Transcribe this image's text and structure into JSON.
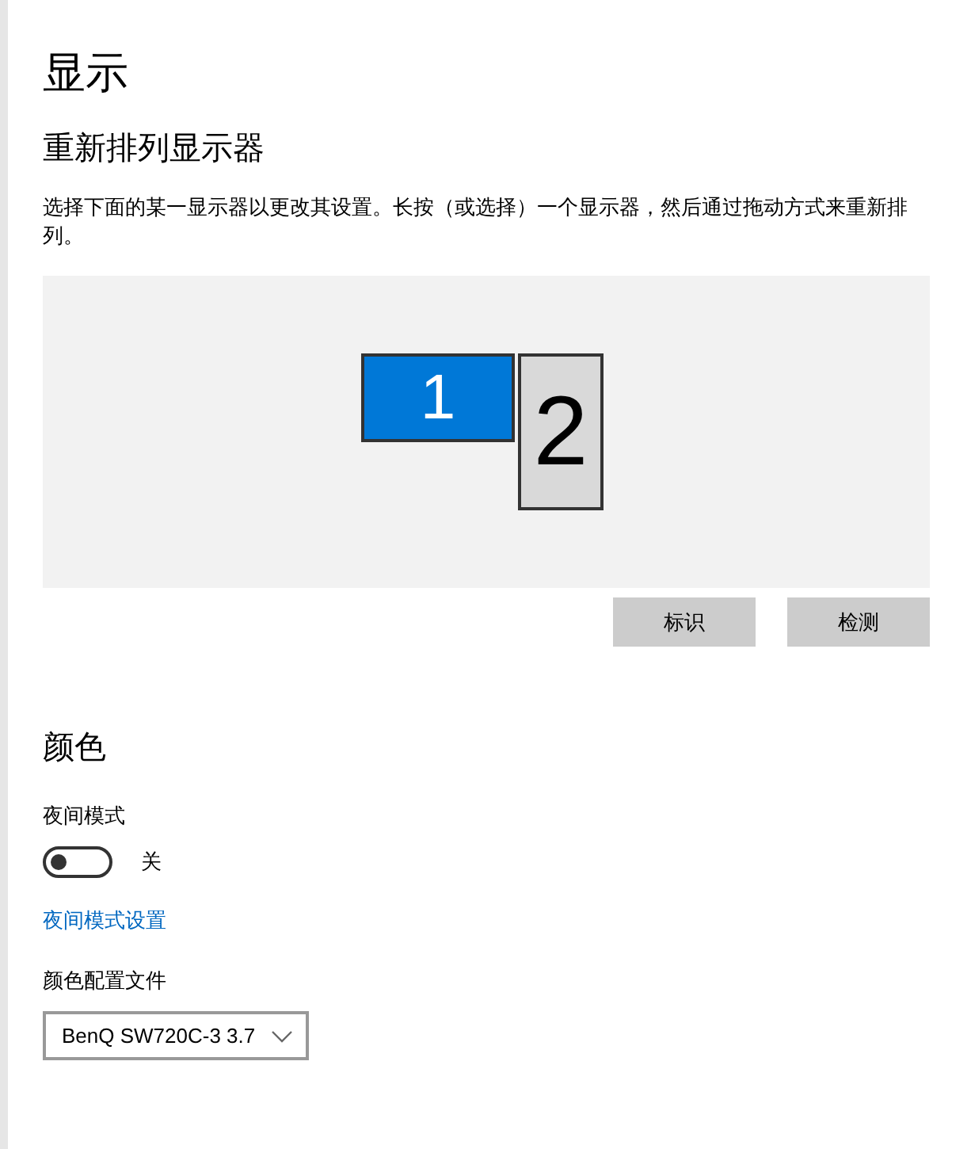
{
  "page_title": "显示",
  "section_title": "重新排列显示器",
  "description": "选择下面的某一显示器以更改其设置。长按（或选择）一个显示器，然后通过拖动方式来重新排列。",
  "monitors": [
    {
      "label": "1",
      "selected": true
    },
    {
      "label": "2",
      "selected": false
    }
  ],
  "buttons": [
    "标识",
    "检测"
  ],
  "color_title": "颜色",
  "night_mode": {
    "label": "夜间模式",
    "on": false,
    "state_text": "关"
  },
  "night_mode_link": "夜间模式设置",
  "color_profile": {
    "label": "颜色配置文件",
    "value": "BenQ SW720C-3 3.7"
  }
}
